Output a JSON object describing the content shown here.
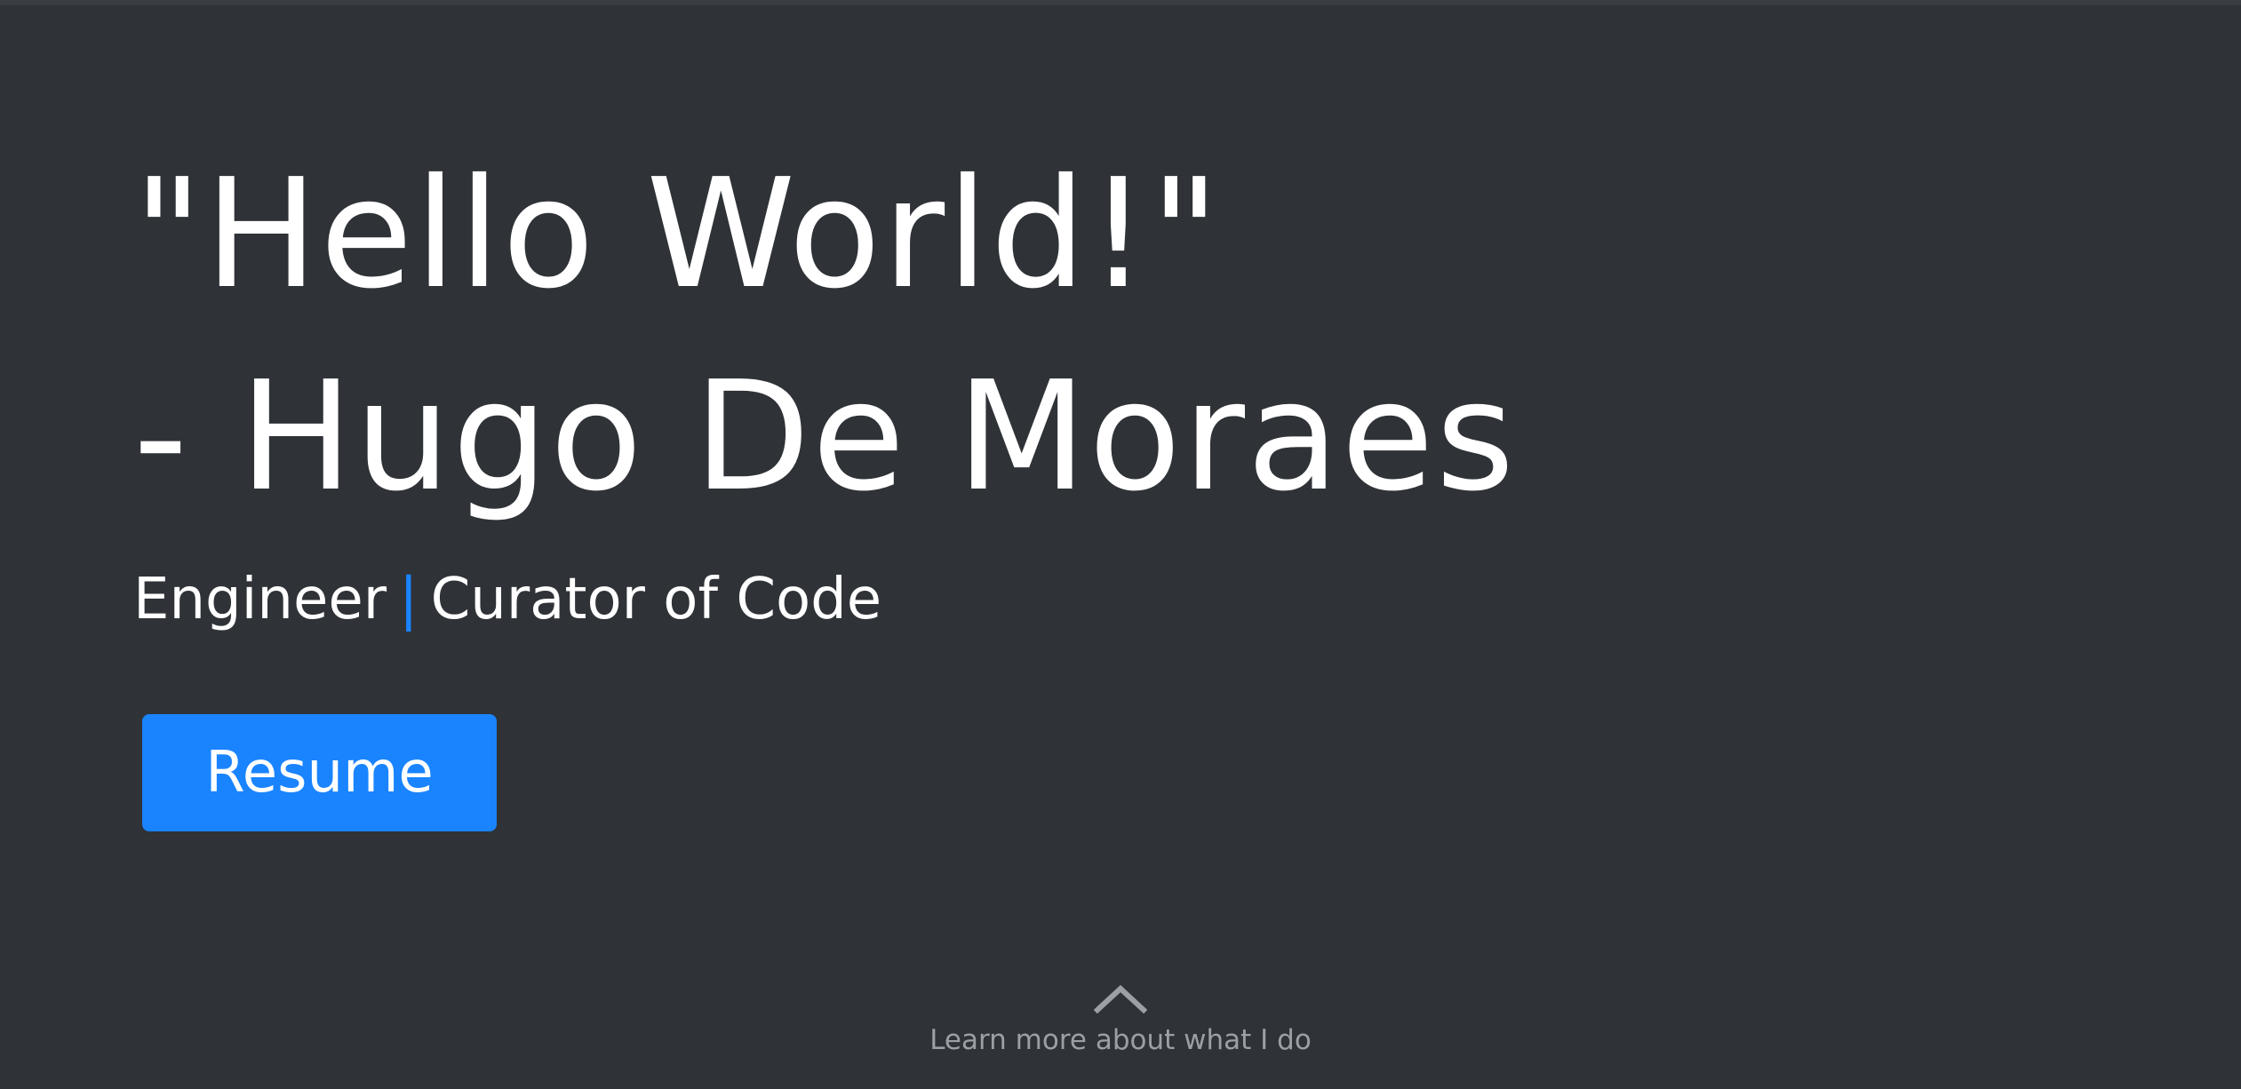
{
  "hero": {
    "headline_line1": "\"Hello World!\"",
    "headline_line2": "- Hugo De Moraes",
    "subtitle_left": "Engineer",
    "subtitle_separator": "|",
    "subtitle_right": "Curator of Code"
  },
  "actions": {
    "resume_label": "Resume"
  },
  "footer": {
    "learn_more_label": "Learn more about what I do",
    "learn_more_icon": "chevron-up-icon"
  },
  "colors": {
    "background": "#2f3237",
    "accent": "#1a84ff",
    "text": "#ffffff",
    "muted": "#9aa0a6"
  }
}
